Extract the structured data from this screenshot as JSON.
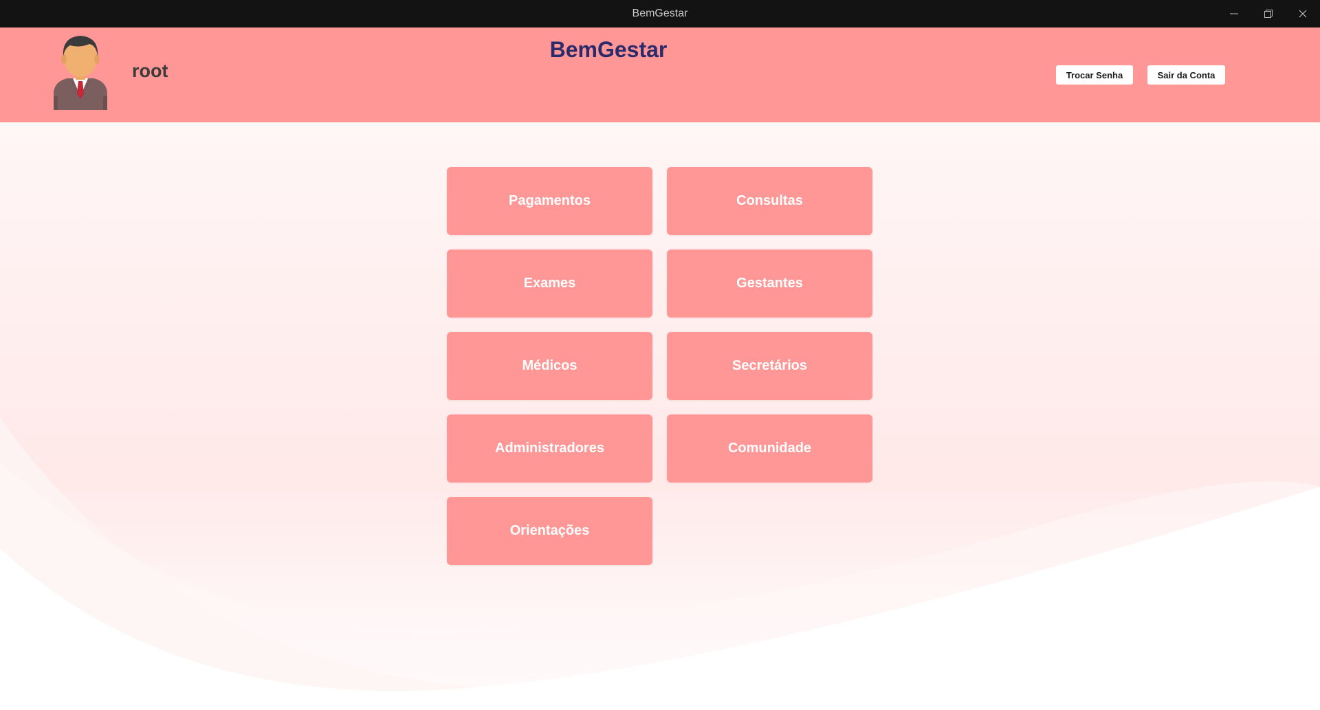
{
  "window": {
    "title": "BemGestar"
  },
  "header": {
    "username": "root",
    "app_title": "BemGestar",
    "change_password_label": "Trocar Senha",
    "logout_label": "Sair da Conta",
    "avatar_icon": "user-avatar-icon"
  },
  "menu": {
    "items": [
      {
        "label": "Pagamentos"
      },
      {
        "label": "Consultas"
      },
      {
        "label": "Exames"
      },
      {
        "label": "Gestantes"
      },
      {
        "label": "Médicos"
      },
      {
        "label": "Secretários"
      },
      {
        "label": "Administradores"
      },
      {
        "label": "Comunidade"
      },
      {
        "label": "Orientações"
      }
    ]
  },
  "colors": {
    "accent": "#ff9797",
    "title": "#2b2a6b",
    "titlebar": "#131313"
  }
}
